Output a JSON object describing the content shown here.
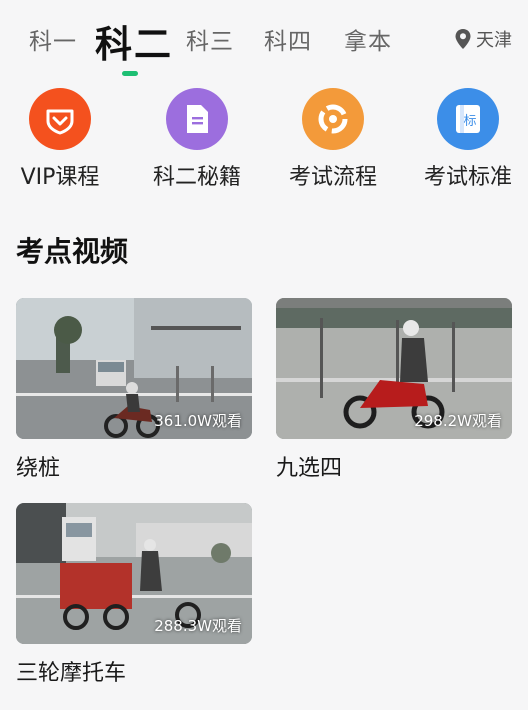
{
  "tabs": [
    "科一",
    "科二",
    "科三",
    "科四",
    "拿本"
  ],
  "active_tab": 1,
  "location": {
    "city": "天津",
    "icon": "location-pin-icon"
  },
  "entries": [
    {
      "label": "VIP课程",
      "icon": "vip-badge-icon",
      "color": "#f4511e"
    },
    {
      "label": "科二秘籍",
      "icon": "document-icon",
      "color": "#9c6ede"
    },
    {
      "label": "考试流程",
      "icon": "flow-ring-icon",
      "color": "#f39a3a"
    },
    {
      "label": "考试标准",
      "icon": "standard-book-icon",
      "color": "#3c8ee8"
    }
  ],
  "section": {
    "title": "考点视频"
  },
  "videos": [
    {
      "title": "绕桩",
      "views": "361.0W观看"
    },
    {
      "title": "九选四",
      "views": "298.2W观看"
    },
    {
      "title": "三轮摩托车",
      "views": "288.3W观看"
    }
  ],
  "colors": {
    "accent": "#1dbf73",
    "background": "#f6f6f7"
  }
}
